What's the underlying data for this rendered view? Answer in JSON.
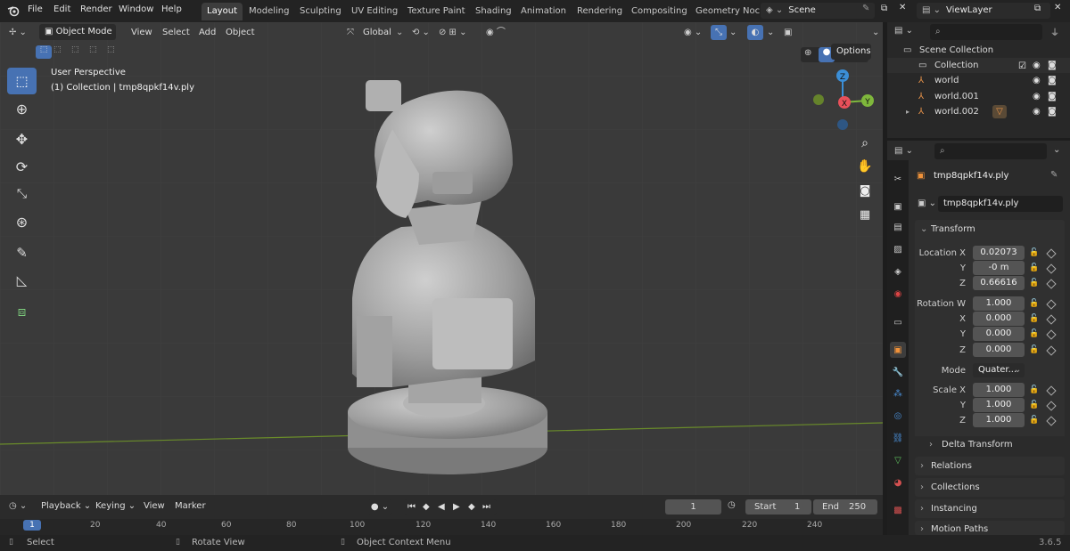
{
  "app": {
    "version": "3.6.5"
  },
  "menus": [
    "File",
    "Edit",
    "Render",
    "Window",
    "Help"
  ],
  "workspaces": [
    "Layout",
    "Modeling",
    "Sculpting",
    "UV Editing",
    "Texture Paint",
    "Shading",
    "Animation",
    "Rendering",
    "Compositing",
    "Geometry Noc"
  ],
  "active_workspace": "Layout",
  "scene": "Scene",
  "view_layer": "ViewLayer",
  "viewport_header": {
    "mode": "Object Mode",
    "menus": [
      "View",
      "Select",
      "Add",
      "Object"
    ],
    "orientation": "Global",
    "options": "Options"
  },
  "viewport": {
    "perspective": "User Perspective",
    "info": "(1) Collection | tmp8qpkf14v.ply"
  },
  "gizmo": {
    "z": "Z",
    "x": "X",
    "y": "Y"
  },
  "outliner": {
    "scene_collection": "Scene Collection",
    "collection": "Collection",
    "items": [
      "world",
      "world.001",
      "world.002"
    ]
  },
  "properties": {
    "object_name": "tmp8qpkf14v.ply",
    "data_name": "tmp8qpkf14v.ply",
    "transform_label": "Transform",
    "location_label": "Location X",
    "y_label": "Y",
    "z_label": "Z",
    "w_label": "Rotation W",
    "x_label": "X",
    "location": {
      "x": "0.02073",
      "y": "-0 m",
      "z": "0.66616"
    },
    "rotation": {
      "w": "1.000",
      "x": "0.000",
      "y": "0.000",
      "z": "0.000"
    },
    "mode_label": "Mode",
    "mode_value": "Quater...",
    "scale_label": "Scale X",
    "scale": {
      "x": "1.000",
      "y": "1.000",
      "z": "1.000"
    },
    "sections": [
      "Delta Transform",
      "Relations",
      "Collections",
      "Instancing",
      "Motion Paths"
    ]
  },
  "timeline": {
    "menus": [
      "Playback",
      "Keying",
      "View",
      "Marker"
    ],
    "current_frame": "1",
    "start_label": "Start",
    "start": "1",
    "end_label": "End",
    "end": "250",
    "ticks": [
      "1",
      "20",
      "40",
      "60",
      "80",
      "100",
      "120",
      "140",
      "160",
      "180",
      "200",
      "220",
      "240"
    ]
  },
  "status": {
    "select": "Select",
    "rotate": "Rotate View",
    "context": "Object Context Menu"
  },
  "colors": {
    "accent": "#4772b3",
    "x_axis": "#e8505a",
    "y_axis": "#7fb73c",
    "z_axis": "#3b8ed6",
    "viewport_bg": "#3a3a3a"
  }
}
